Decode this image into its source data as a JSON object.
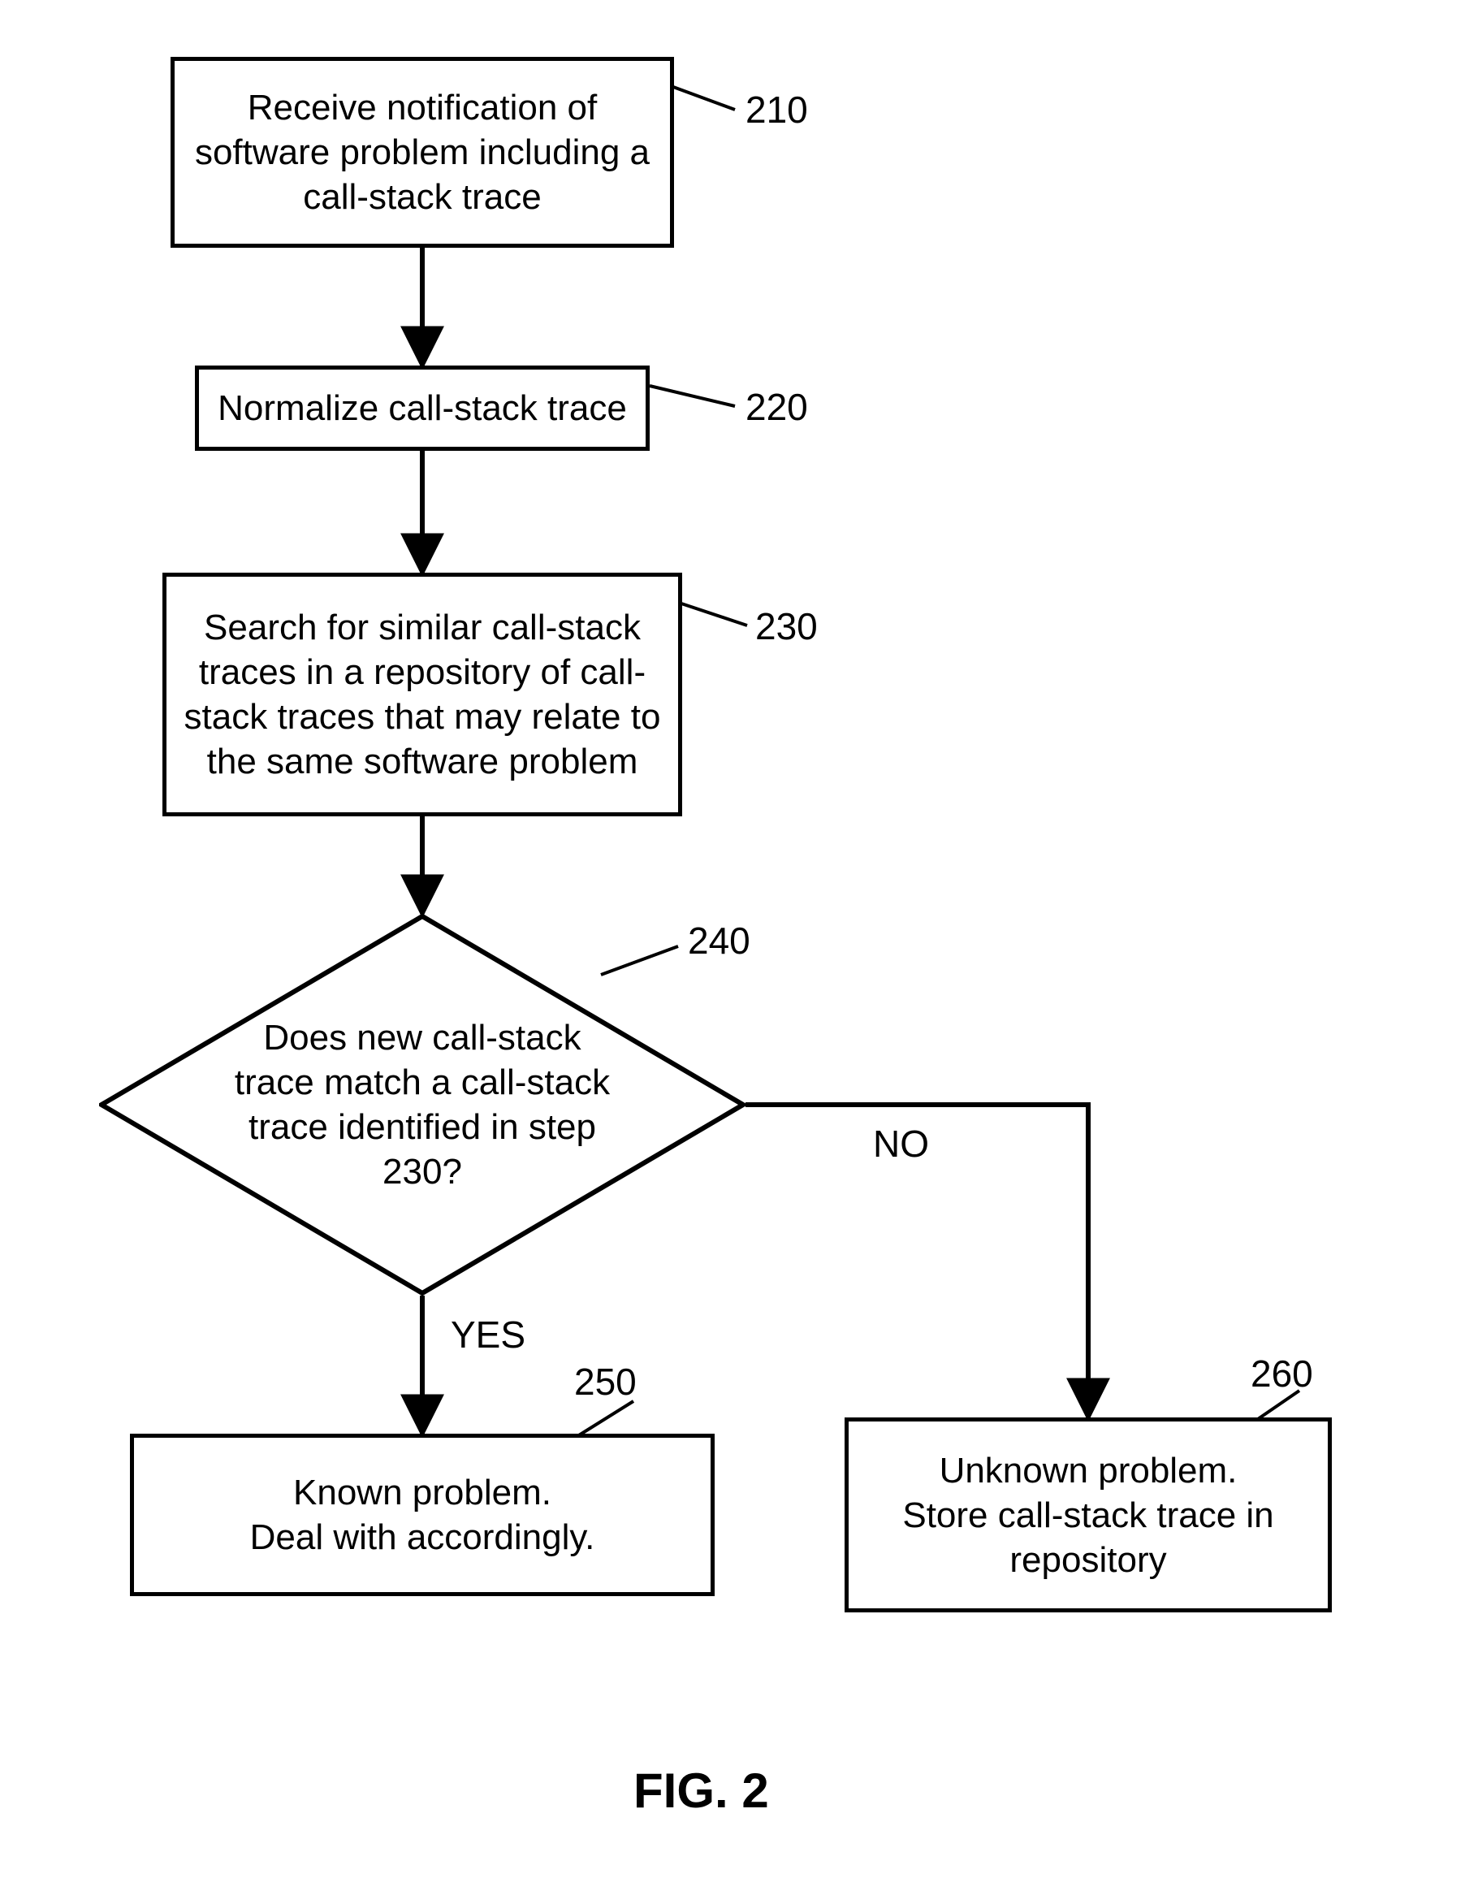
{
  "nodes": {
    "n210": {
      "text": "Receive notification of software problem including a call-stack trace",
      "ref": "210"
    },
    "n220": {
      "text": "Normalize call-stack trace",
      "ref": "220"
    },
    "n230": {
      "text": "Search for similar call-stack traces in a repository of call-stack traces that may relate to the same software problem",
      "ref": "230"
    },
    "n240": {
      "text": "Does new call-stack trace match a call-stack trace identified in step 230?",
      "ref": "240"
    },
    "n250": {
      "text": "Known problem.\nDeal with accordingly.",
      "ref": "250"
    },
    "n260": {
      "text": "Unknown problem.\nStore call-stack trace in repository",
      "ref": "260"
    }
  },
  "edges": {
    "yes": "YES",
    "no": "NO"
  },
  "figure_title": "FIG. 2"
}
